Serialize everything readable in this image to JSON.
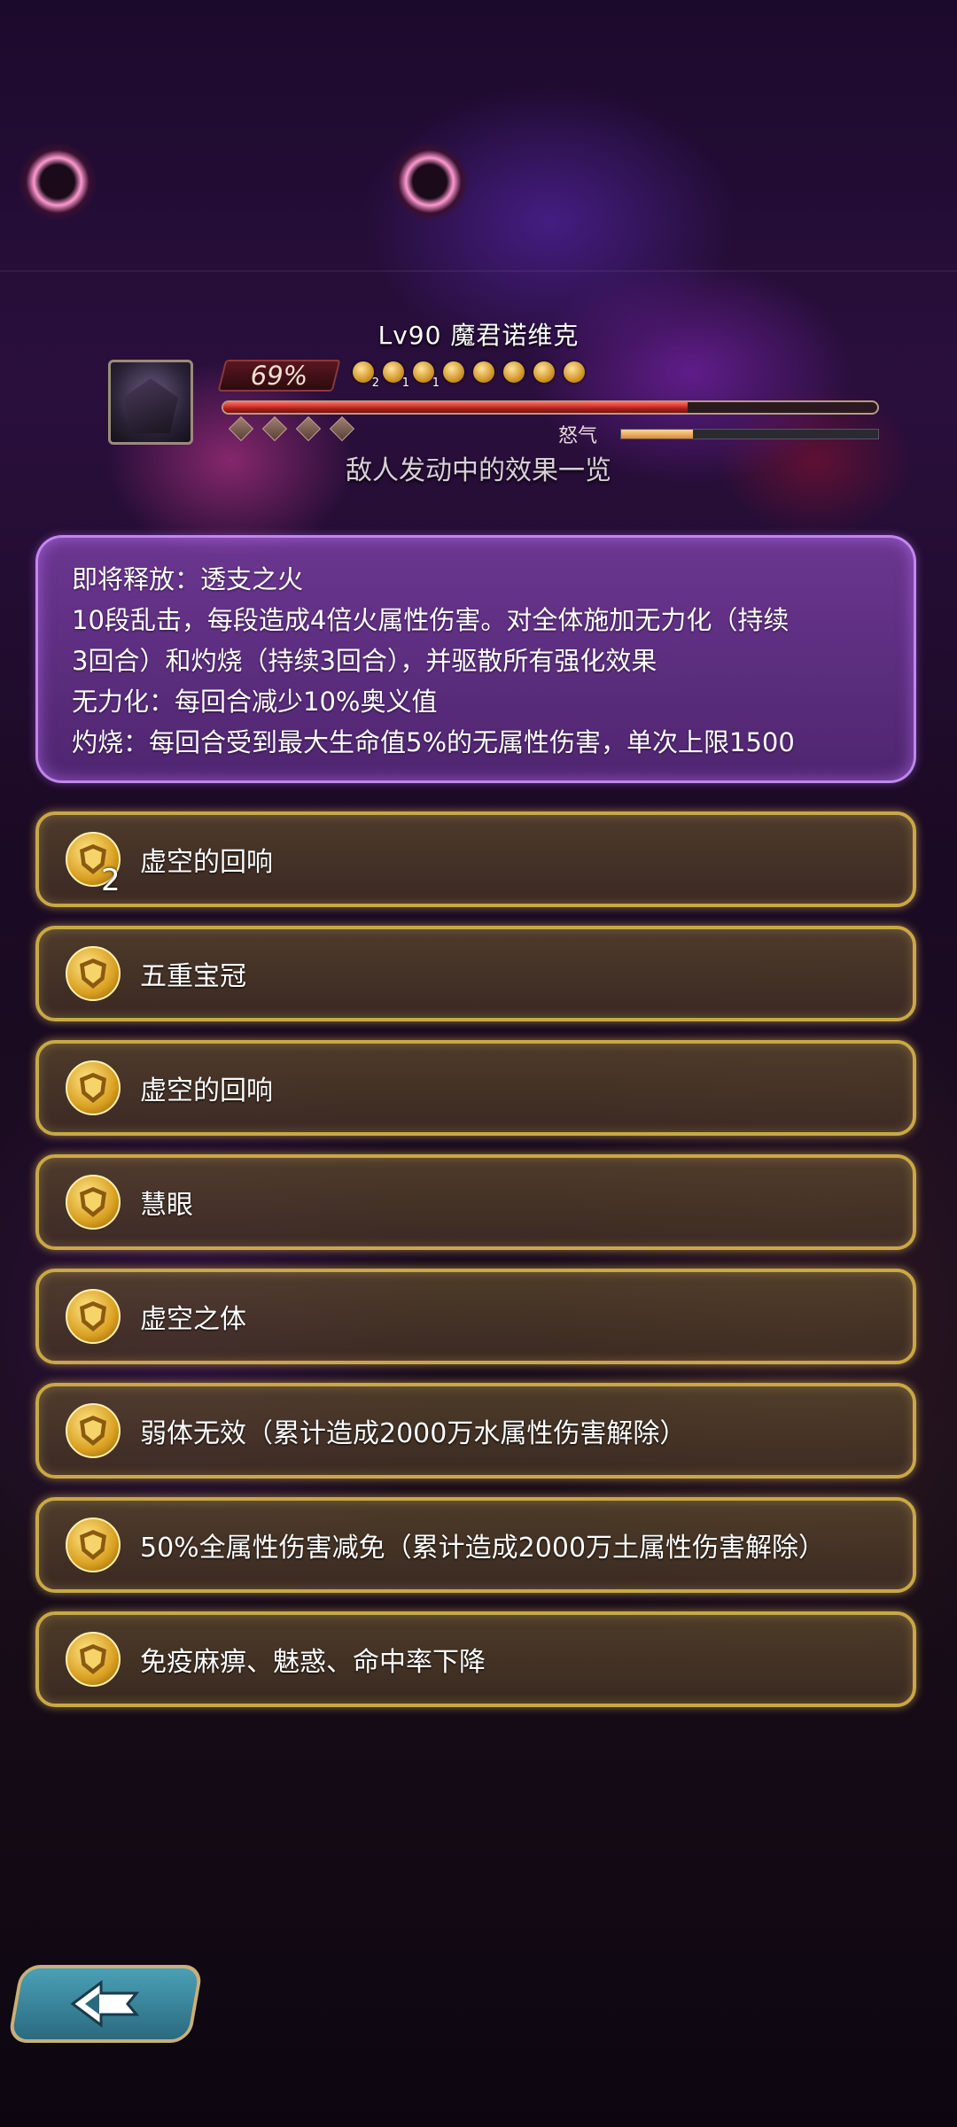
{
  "boss": {
    "name": "Lv90 魔君诺维克",
    "hp_percent_label": "69%",
    "hp_fraction": 0.71,
    "rage_label": "怒气",
    "rage_fraction": 0.28,
    "medal_counts": [
      "2",
      "1",
      "1"
    ]
  },
  "subtitle": "敌人发动中的效果一览",
  "skill": {
    "lines": [
      "即将释放：透支之火",
      "10段乱击，每段造成4倍火属性伤害。对全体施加无力化（持续",
      "3回合）和灼烧（持续3回合），并驱散所有强化效果",
      "无力化：每回合减少10%奥义值",
      "灼烧：每回合受到最大生命值5%的无属性伤害，单次上限1500"
    ]
  },
  "effects": [
    {
      "label": "虚空的回响",
      "count": "2"
    },
    {
      "label": "五重宝冠"
    },
    {
      "label": "虚空的回响"
    },
    {
      "label": "慧眼"
    },
    {
      "label": "虚空之体"
    },
    {
      "label": "弱体无效（累计造成2000万水属性伤害解除）"
    },
    {
      "label": "50%全属性伤害减免（累计造成2000万土属性伤害解除）"
    },
    {
      "label": "免疫麻痹、魅惑、命中率下降"
    }
  ],
  "colors": {
    "panel_border": "#d296ff",
    "effect_border": "#c9a845",
    "hp_fill": "#b0201a",
    "rage_fill": "#d88a3a"
  },
  "icons": {
    "effect_badge": "buff-shield-icon",
    "back": "back-arrow-icon"
  }
}
